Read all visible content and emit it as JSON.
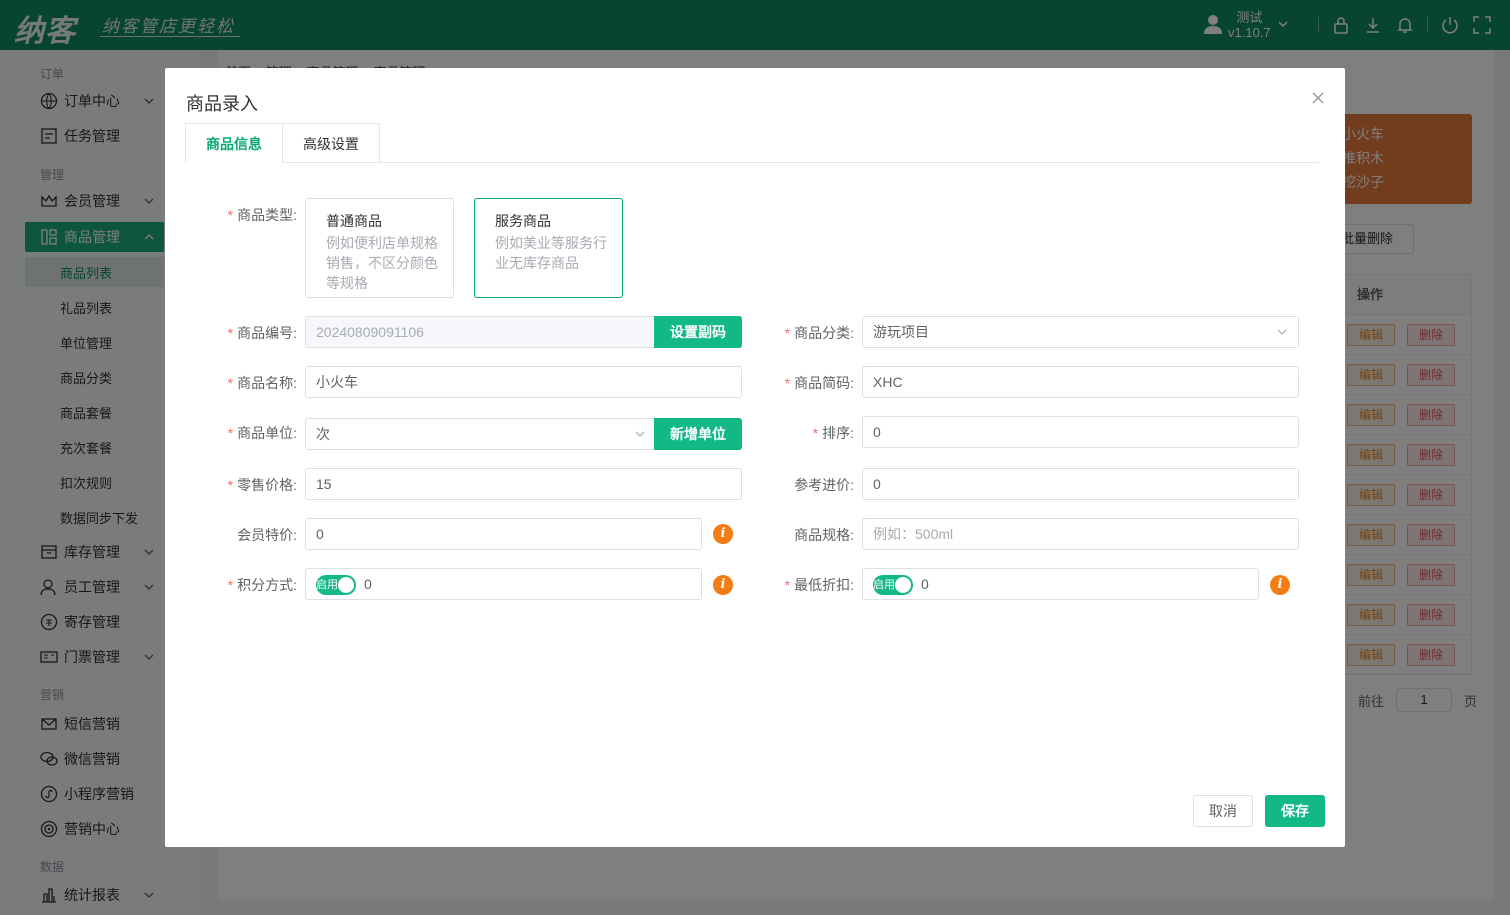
{
  "topbar": {
    "logo": "纳客",
    "slogan": "纳客管店更轻松",
    "user_name": "测试",
    "version": "v1.10.7"
  },
  "sidebar": {
    "section_order": "订单",
    "order_center": "订单中心",
    "task_mgmt": "任务管理",
    "section_manage": "管理",
    "member_mgmt": "会员管理",
    "goods_mgmt": "商品管理",
    "goods_list": "商品列表",
    "gift_list": "礼品列表",
    "unit_mgmt": "单位管理",
    "goods_category": "商品分类",
    "goods_package": "商品套餐",
    "recharge_package": "充次套餐",
    "deduct_rules": "扣次规则",
    "data_sync": "数据同步下发",
    "stock_mgmt": "库存管理",
    "staff_mgmt": "员工管理",
    "deposit_mgmt": "寄存管理",
    "ticket_mgmt": "门票管理",
    "section_marketing": "营销",
    "sms_marketing": "短信营销",
    "wechat_marketing": "微信营销",
    "miniapp_marketing": "小程序营销",
    "marketing_center": "营销中心",
    "section_data": "数据",
    "stats_report": "统计报表"
  },
  "background": {
    "breadcrumb": "首页 > 管理 > 商品管理 > 商品管理",
    "orange_lines": [
      "小火车",
      "推积木",
      "挖沙子"
    ],
    "batch_delete": "批量删除",
    "op_header": "操作",
    "edit_label": "编辑",
    "delete_label": "删除",
    "rows": 9,
    "goto_label": "前往",
    "page_value": "1",
    "page_unit": "页"
  },
  "modal": {
    "title": "商品录入",
    "tabs": [
      "商品信息",
      "高级设置"
    ],
    "type_label": "商品类型:",
    "type_cards": [
      {
        "title": "普通商品",
        "desc": "例如便利店单规格销售，不区分颜色等规格"
      },
      {
        "title": "服务商品",
        "desc": "例如美业等服务行业无库存商品"
      }
    ],
    "code_label": "商品编号:",
    "code_value": "20240809091106",
    "set_code_btn": "设置副码",
    "category_label": "商品分类:",
    "category_value": "游玩项目",
    "name_label": "商品名称:",
    "name_value": "小火车",
    "short_label": "商品简码:",
    "short_value": "XHC",
    "unit_label": "商品单位:",
    "unit_value": "次",
    "add_unit_btn": "新增单位",
    "sort_label": "排序:",
    "sort_value": "0",
    "price_label": "零售价格:",
    "price_value": "15",
    "cost_label": "参考进价:",
    "cost_value": "0",
    "member_price_label": "会员特价:",
    "member_price_value": "0",
    "spec_label": "商品规格:",
    "spec_placeholder": "例如：500ml",
    "points_label": "积分方式:",
    "points_switch": "启用",
    "points_value": "0",
    "discount_label": "最低折扣:",
    "discount_switch": "启用",
    "discount_value": "0",
    "cancel_btn": "取消",
    "save_btn": "保存"
  },
  "colors": {
    "brand": "#0e8a5f",
    "accent": "#12b886",
    "warning": "#f57c14",
    "required": "#f56c6c"
  }
}
